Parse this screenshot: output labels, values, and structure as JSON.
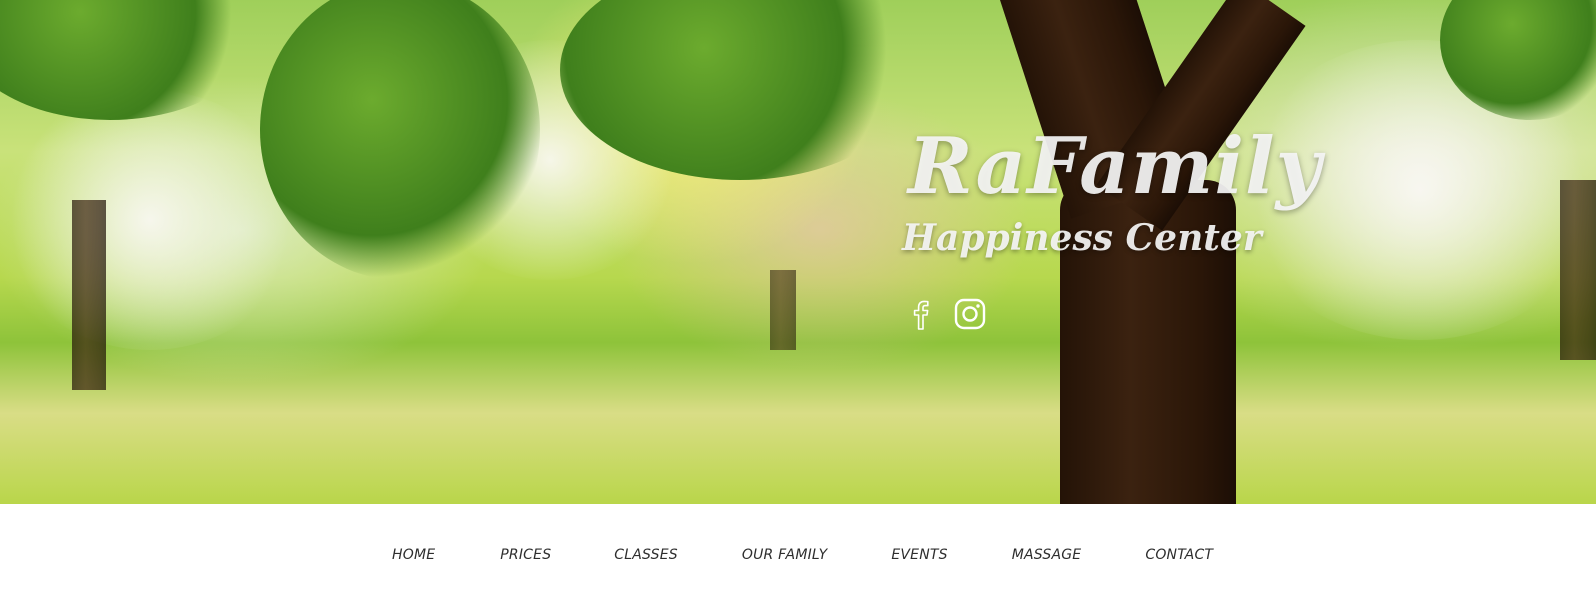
{
  "brand": {
    "title": "RaFamily",
    "subtitle": "Happiness Center"
  },
  "social": [
    {
      "icon": "facebook-icon"
    },
    {
      "icon": "instagram-icon"
    }
  ],
  "nav": {
    "items": [
      {
        "label": "HOME"
      },
      {
        "label": "PRICES"
      },
      {
        "label": "CLASSES"
      },
      {
        "label": "OUR FAMILY"
      },
      {
        "label": "EVENTS"
      },
      {
        "label": "MASSAGE"
      },
      {
        "label": "CONTACT"
      }
    ]
  },
  "colors": {
    "nav_text": "#2e2e2e",
    "brand_text": "#f5f5f5",
    "background": "#ffffff"
  }
}
